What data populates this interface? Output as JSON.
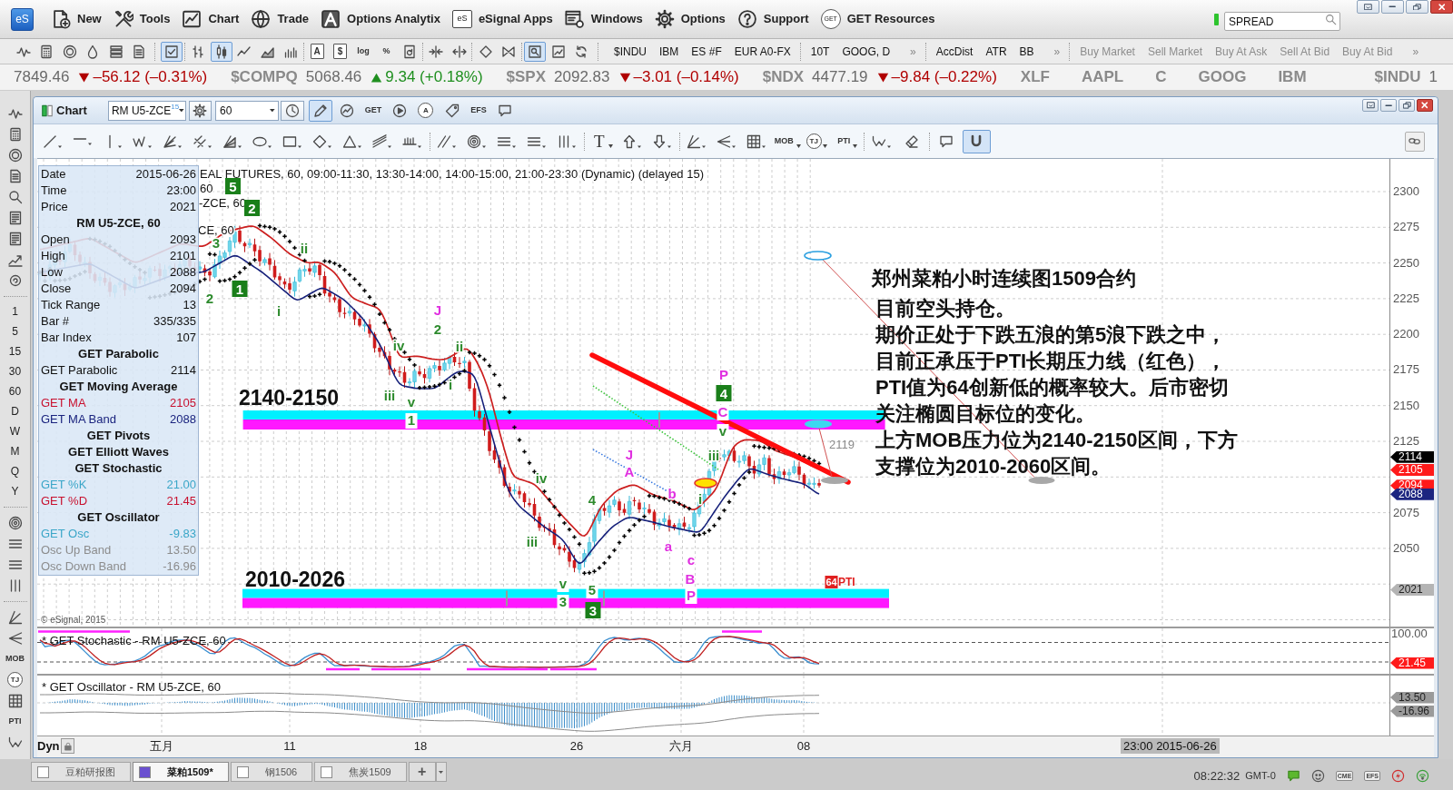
{
  "app_bar": {
    "logo": "eS",
    "menu": [
      {
        "kind": "new",
        "label": "New"
      },
      {
        "kind": "tools",
        "label": "Tools"
      },
      {
        "kind": "chart",
        "label": "Chart"
      },
      {
        "kind": "trade",
        "label": "Trade"
      },
      {
        "kind": "analytix",
        "label": "Options Analytix"
      },
      {
        "kind": "apps",
        "label": "eSignal Apps",
        "badge": "eS"
      },
      {
        "kind": "windows",
        "label": "Windows"
      },
      {
        "kind": "options",
        "label": "Options"
      },
      {
        "kind": "support",
        "label": "Support"
      },
      {
        "kind": "resources",
        "label": "GET Resources",
        "badge": "GET"
      }
    ],
    "search": {
      "value": "SPREAD"
    }
  },
  "main_toolbar": {
    "tools": [
      [
        {
          "kind": "wave",
          "selected": false
        },
        {
          "kind": "calculator",
          "selected": false
        },
        {
          "kind": "coin",
          "selected": false
        },
        {
          "kind": "drop",
          "selected": false
        },
        {
          "kind": "stack",
          "selected": false
        },
        {
          "kind": "sheet",
          "selected": false
        }
      ],
      [
        {
          "kind": "check-sheet",
          "selected": true
        }
      ],
      [
        {
          "kind": "ohlc",
          "selected": false
        },
        {
          "kind": "candles",
          "selected": true
        },
        {
          "kind": "line",
          "selected": false
        },
        {
          "kind": "area",
          "selected": false
        },
        {
          "kind": "volume",
          "selected": false
        }
      ],
      [
        {
          "kind": "glyph-sheet",
          "text": "A",
          "selected": false
        },
        {
          "kind": "glyph-sheet",
          "text": "$",
          "selected": false
        },
        {
          "kind": "glyph",
          "text": "log",
          "selected": false
        },
        {
          "kind": "glyph",
          "text": "%",
          "selected": false
        },
        {
          "kind": "refresh-sheet",
          "selected": false
        }
      ],
      [
        {
          "kind": "split-in",
          "selected": false
        },
        {
          "kind": "split-out",
          "selected": false
        }
      ],
      [
        {
          "kind": "diamond",
          "selected": false
        },
        {
          "kind": "bowtie",
          "selected": false
        }
      ],
      [
        {
          "kind": "zoom-sheet",
          "selected": true
        },
        {
          "kind": "chart-sheet",
          "selected": false
        },
        {
          "kind": "refresh",
          "selected": false
        }
      ]
    ],
    "links": [
      {
        "items": [
          "$INDU",
          "IBM",
          "ES #F",
          "EUR A0-FX"
        ],
        "disabled": false
      },
      {
        "items": [
          "10T",
          "GOOG, D"
        ],
        "more": "»",
        "disabled": false
      },
      {
        "items": [
          "AccDist",
          "ATR",
          "BB"
        ],
        "more": "»",
        "disabled": false
      },
      {
        "items": [
          "Buy Market",
          "Sell Market",
          "Buy At Ask",
          "Sell At Bid",
          "Buy At Bid"
        ],
        "more": "»",
        "disabled": true
      }
    ]
  },
  "ticker": [
    {
      "value": "7849.46",
      "falling": true,
      "change": "–56.12 (–0.31%)"
    },
    {
      "symbol": "$COMPQ",
      "value": "5068.46",
      "falling": false,
      "change": "9.34 (+0.18%)"
    },
    {
      "symbol": "$SPX",
      "value": "2092.83",
      "falling": true,
      "change": "–3.01 (–0.14%)"
    },
    {
      "symbol": "$NDX",
      "value": "4477.19",
      "falling": true,
      "change": "–9.84 (–0.22%)"
    },
    {
      "symbol": "XLF"
    },
    {
      "symbol": "AAPL"
    },
    {
      "symbol": "C"
    },
    {
      "symbol": "GOOG"
    },
    {
      "symbol": "IBM"
    },
    {
      "symbol": "$INDU",
      "value": "1"
    }
  ],
  "left_rail": {
    "tools": [
      {
        "kind": "wave"
      },
      {
        "kind": "calculator"
      },
      {
        "kind": "coin"
      },
      {
        "kind": "sheet"
      },
      {
        "kind": "zoom"
      },
      {
        "kind": "list-sheet"
      },
      {
        "kind": "list-sheet"
      },
      {
        "kind": "chart-up"
      },
      {
        "kind": "coin-refresh"
      }
    ],
    "intervals": [
      "1",
      "5",
      "15",
      "30",
      "60",
      "D",
      "W",
      "M",
      "Q",
      "Y"
    ],
    "study_tools": [
      {
        "kind": "rings"
      },
      {
        "kind": "lines3"
      },
      {
        "kind": "lines3"
      },
      {
        "kind": "bars3"
      }
    ],
    "draw_tools": [
      {
        "kind": "angle"
      },
      {
        "kind": "fan-left"
      },
      {
        "kind": "glyph",
        "text": "MOB"
      },
      {
        "kind": "glyph-circle",
        "text": "TJ"
      },
      {
        "kind": "grid"
      },
      {
        "kind": "glyph",
        "text": "PTI"
      },
      {
        "kind": "zigzag"
      }
    ]
  },
  "chart_window": {
    "title": "Chart",
    "symbol": "RM U5-ZCE",
    "symbol_badge": "15",
    "interval": "60",
    "tools": [
      {
        "kind": "pencil",
        "selected": true
      },
      {
        "kind": "chart-circle",
        "selected": false
      },
      {
        "kind": "glyph",
        "text": "GET",
        "selected": false
      },
      {
        "kind": "play",
        "selected": false
      },
      {
        "kind": "glyph-circle",
        "text": "A",
        "selected": false
      },
      {
        "kind": "tag",
        "selected": false
      },
      {
        "kind": "glyph",
        "text": "EFS",
        "selected": false
      },
      {
        "kind": "comment",
        "selected": false
      }
    ],
    "drawing_tools": [
      [
        {
          "kind": "slash",
          "selected": false
        },
        {
          "kind": "hline",
          "selected": false
        },
        {
          "kind": "vline",
          "selected": false
        },
        {
          "kind": "zigzag-tool",
          "selected": false
        },
        {
          "kind": "fan",
          "selected": false
        },
        {
          "kind": "cross",
          "selected": false
        },
        {
          "kind": "fan-fill",
          "selected": false
        },
        {
          "kind": "ellipse",
          "selected": false
        },
        {
          "kind": "rect",
          "selected": false
        },
        {
          "kind": "rhombus",
          "selected": false
        },
        {
          "kind": "triangle",
          "selected": false
        },
        {
          "kind": "channel",
          "selected": false
        },
        {
          "kind": "comb",
          "selected": false
        }
      ],
      [
        {
          "kind": "dslash",
          "selected": false
        },
        {
          "kind": "rings",
          "selected": false
        },
        {
          "kind": "lines3",
          "selected": false
        },
        {
          "kind": "lines3",
          "selected": false
        },
        {
          "kind": "bars3",
          "selected": false
        }
      ],
      [
        {
          "kind": "glyph-large",
          "text": "T",
          "selected": false
        },
        {
          "kind": "arrow-up",
          "selected": false
        },
        {
          "kind": "arrow-down",
          "selected": false
        }
      ],
      [
        {
          "kind": "angle",
          "selected": false
        },
        {
          "kind": "fan-left",
          "selected": false
        },
        {
          "kind": "grid",
          "selected": false
        },
        {
          "kind": "glyph",
          "text": "MOB",
          "selected": false
        },
        {
          "kind": "glyph-circle",
          "text": "TJ",
          "selected": false
        },
        {
          "kind": "glyph",
          "text": "PTI",
          "selected": false
        }
      ],
      [
        {
          "kind": "zigzag",
          "selected": false
        },
        {
          "kind": "eraser",
          "selected": false
        }
      ],
      [
        {
          "kind": "comment",
          "selected": false
        },
        {
          "kind": "magnet",
          "selected": true
        }
      ]
    ],
    "main_chart": {
      "legend": [
        "EAL FUTURES, 60, 09:00-11:30, 13:30-14:00, 14:00-15:00, 21:00-23:30 (Dynamic) (delayed 15)",
        "60",
        "-ZCE, 60",
        "CE, 60"
      ],
      "data_window": {
        "rows": [
          {
            "kind": "field",
            "label": "Date",
            "value": "2015-06-26"
          },
          {
            "kind": "field",
            "label": "Time",
            "value": "23:00"
          },
          {
            "kind": "field",
            "label": "Price",
            "value": "2021"
          },
          {
            "kind": "heading",
            "label": "RM U5-ZCE, 60"
          },
          {
            "kind": "field",
            "label": "Open",
            "value": "2093"
          },
          {
            "kind": "field",
            "label": "High",
            "value": "2101"
          },
          {
            "kind": "field",
            "label": "Low",
            "value": "2088"
          },
          {
            "kind": "field",
            "label": "Close",
            "value": "2094"
          },
          {
            "kind": "field",
            "label": "Tick Range",
            "value": "13"
          },
          {
            "kind": "field",
            "label": "Bar #",
            "value": "335/335"
          },
          {
            "kind": "field",
            "label": "Bar Index",
            "value": "107"
          },
          {
            "kind": "heading",
            "label": "GET Parabolic"
          },
          {
            "kind": "field",
            "label": "GET Parabolic",
            "value": "2114"
          },
          {
            "kind": "heading",
            "label": "GET Moving Average"
          },
          {
            "kind": "field",
            "label": "GET MA",
            "value": "2105",
            "color": "#c8102e"
          },
          {
            "kind": "field",
            "label": "GET MA Band",
            "value": "2088",
            "color": "#1a237e"
          },
          {
            "kind": "heading",
            "label": "GET Pivots"
          },
          {
            "kind": "heading",
            "label": "GET Elliott Waves"
          },
          {
            "kind": "heading",
            "label": "GET Stochastic"
          },
          {
            "kind": "field",
            "label": "GET %K",
            "value": "21.00",
            "color": "#3aa6c8"
          },
          {
            "kind": "field",
            "label": "GET %D",
            "value": "21.45",
            "color": "#c8102e"
          },
          {
            "kind": "heading",
            "label": "GET Oscillator"
          },
          {
            "kind": "field",
            "label": "GET Osc",
            "value": "-9.83",
            "color": "#3aa6c8"
          },
          {
            "kind": "field",
            "label": "Osc Up Band",
            "value": "13.50",
            "color": "#8c8c8c"
          },
          {
            "kind": "field",
            "label": "Osc Down Band",
            "value": "-16.96",
            "color": "#8c8c8c"
          }
        ]
      },
      "zones": [
        {
          "label": "2140-2150"
        },
        {
          "label": "2010-2026"
        }
      ],
      "wave_labels": [
        {
          "text": "5",
          "kind": "boxed",
          "color": "#1a7f1a"
        },
        {
          "text": "2",
          "kind": "boxed",
          "color": "#1a7f1a"
        },
        {
          "text": "3",
          "kind": "plain",
          "color": "#2e8b2e"
        },
        {
          "text": "ii",
          "kind": "plain",
          "color": "#2e8b2e"
        },
        {
          "text": "1",
          "kind": "boxed",
          "color": "#1a7f1a"
        },
        {
          "text": "2",
          "kind": "plain",
          "color": "#2e8b2e"
        },
        {
          "text": "i",
          "kind": "plain",
          "color": "#2e8b2e"
        },
        {
          "text": "J",
          "kind": "plain",
          "color": "#e030e0"
        },
        {
          "text": "2",
          "kind": "plain",
          "color": "#2e8b2e"
        },
        {
          "text": "iv",
          "kind": "plain",
          "color": "#2e8b2e"
        },
        {
          "text": "ii",
          "kind": "plain",
          "color": "#2e8b2e"
        },
        {
          "text": "i",
          "kind": "plain",
          "color": "#2e8b2e"
        },
        {
          "text": "iii",
          "kind": "plain",
          "color": "#2e8b2e"
        },
        {
          "text": "v",
          "kind": "plain",
          "color": "#2e8b2e"
        },
        {
          "text": "1",
          "kind": "plain",
          "color": "#2e8b2e"
        },
        {
          "text": "iv",
          "kind": "plain",
          "color": "#2e8b2e"
        },
        {
          "text": "iii",
          "kind": "plain",
          "color": "#2e8b2e"
        },
        {
          "text": "v",
          "kind": "plain",
          "color": "#2e8b2e"
        },
        {
          "text": "3",
          "kind": "plain",
          "color": "#2e8b2e"
        },
        {
          "text": "4",
          "kind": "plain",
          "color": "#2e8b2e"
        },
        {
          "text": "5",
          "kind": "plain",
          "color": "#2e8b2e"
        },
        {
          "text": "3",
          "kind": "boxed",
          "color": "#1a7f1a"
        },
        {
          "text": "J",
          "kind": "plain",
          "color": "#e030e0"
        },
        {
          "text": "A",
          "kind": "plain",
          "color": "#e030e0"
        },
        {
          "text": "b",
          "kind": "plain",
          "color": "#e030e0"
        },
        {
          "text": "a",
          "kind": "plain",
          "color": "#e030e0"
        },
        {
          "text": "c",
          "kind": "plain",
          "color": "#e030e0"
        },
        {
          "text": "B",
          "kind": "plain",
          "color": "#e030e0"
        },
        {
          "text": "P",
          "kind": "plain",
          "color": "#e030e0"
        },
        {
          "text": "i",
          "kind": "plain",
          "color": "#2e8b2e"
        },
        {
          "text": "iii",
          "kind": "plain",
          "color": "#2e8b2e"
        },
        {
          "text": "P",
          "kind": "plain",
          "color": "#e030e0"
        },
        {
          "text": "4",
          "kind": "boxed",
          "color": "#1a7f1a"
        },
        {
          "text": "C",
          "kind": "plain",
          "color": "#e030e0"
        },
        {
          "text": "v",
          "kind": "plain",
          "color": "#2e8b2e"
        }
      ],
      "level_label": "2119",
      "pti": {
        "value": "64",
        "label": "PTI"
      },
      "note": [
        "郑州菜粕小时连续图1509合约",
        "目前空头持仓。",
        "期价正处于下跌五浪的第5浪下跌之中，",
        "目前正承压于PTI长期压力线（红色），",
        "PTI值为64创新低的概率较大。后市密切",
        "关注椭圆目标位的变化。",
        "上方MOB压力位为2140-2150区间，下方",
        "支撑位为2010-2060区间。"
      ],
      "copyright": "© eSignal, 2015",
      "price_axis": [
        "2300",
        "2275",
        "2250",
        "2225",
        "2200",
        "2175",
        "2150",
        "2125",
        "2075",
        "2050"
      ],
      "price_tags": [
        {
          "value": "2114",
          "color": "#000000"
        },
        {
          "value": "2105",
          "color": "#ff1a1a"
        },
        {
          "value": "2094",
          "color": "#ff1a1a"
        },
        {
          "value": "2088",
          "color": "#1c2580"
        },
        {
          "value": "2021",
          "color": "#b4b4b4"
        }
      ]
    },
    "stochastic": {
      "title": "* GET Stochastic - RM U5-ZCE, 60",
      "axis": [
        "100.00"
      ],
      "tag": {
        "value": "21.45",
        "color": "#ff1a1a"
      }
    },
    "oscillator": {
      "title": "* GET Oscillator - RM U5-ZCE, 60",
      "tags": [
        {
          "value": "13.50",
          "color": "#9a9a9a"
        },
        {
          "value": "-16.96",
          "color": "#9a9a9a"
        }
      ]
    },
    "x_axis": {
      "mode": "Dyn",
      "labels": [
        "五月",
        "11",
        "18",
        "26",
        "六月",
        "08"
      ],
      "cursor": "23:00 2015-06-26"
    }
  },
  "bottom_bar": {
    "tabs": [
      {
        "label": "豆粕研报图",
        "color": "#ffffff",
        "selected": false
      },
      {
        "label": "菜粕1509*",
        "color": "#6a50d0",
        "selected": true
      },
      {
        "label": "钢1506",
        "color": "#ffffff",
        "selected": false
      },
      {
        "label": "焦炭1509",
        "color": "#ffffff",
        "selected": false
      }
    ],
    "add": "+",
    "clock": "08:22:32",
    "zone": "GMT-0",
    "status_icons": [
      {
        "kind": "chat"
      },
      {
        "kind": "face"
      },
      {
        "kind": "glyph",
        "text": "CME"
      },
      {
        "kind": "glyph",
        "text": "EFS"
      },
      {
        "kind": "lightning"
      },
      {
        "kind": "signal"
      }
    ]
  }
}
